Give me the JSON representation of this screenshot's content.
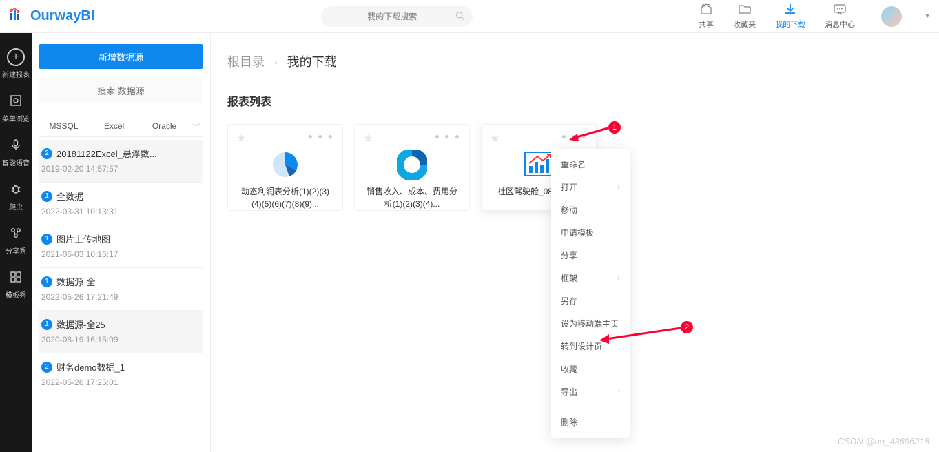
{
  "app_name": "OurwayBI",
  "search_placeholder": "我的下载搜索",
  "top_actions": {
    "share": "共享",
    "favorites": "收藏夹",
    "downloads": "我的下载",
    "messages": "消息中心"
  },
  "rail": {
    "new_report": "新建报表",
    "browse": "菜单浏览",
    "voice": "智能语音",
    "spider": "爬虫",
    "share_show": "分享秀",
    "template_show": "模板秀"
  },
  "sidebar": {
    "add_ds_label": "新增数据源",
    "search_ds_placeholder": "搜索 数据源",
    "tabs": [
      "MSSQL",
      "Excel",
      "Oracle"
    ],
    "items": [
      {
        "badge": "2",
        "name": "20181122Excel_悬浮数...",
        "time": "2019-02-20 14:57:57"
      },
      {
        "badge": "1",
        "name": "全数据",
        "time": "2022-03-31 10:13:31"
      },
      {
        "badge": "1",
        "name": "图片上传地图",
        "time": "2021-06-03 10:16:17"
      },
      {
        "badge": "1",
        "name": "数据源-全",
        "time": "2022-05-26 17:21:49"
      },
      {
        "badge": "1",
        "name": "数据源-全25",
        "time": "2020-08-19 16:15:09"
      },
      {
        "badge": "2",
        "name": "财务demo数据_1",
        "time": "2022-05-26 17:25:01"
      }
    ]
  },
  "breadcrumb": {
    "root": "根目录",
    "current": "我的下载"
  },
  "section_title": "报表列表",
  "cards": [
    {
      "title": "动态利润表分析(1)(2)(3)(4)(5)(6)(7)(8)(9)..."
    },
    {
      "title": "销售收入、成本、费用分析(1)(2)(3)(4)..."
    },
    {
      "title": "社区驾驶舱_08191615"
    }
  ],
  "context_menu": {
    "rename": "重命名",
    "open": "打开",
    "move": "移动",
    "apply_template": "申请模板",
    "share": "分享",
    "frame": "框架",
    "save_as": "另存",
    "set_mobile_home": "设为移动端主页",
    "goto_design": "转到设计页",
    "favorite": "收藏",
    "export": "导出",
    "delete": "删除"
  },
  "annotations": {
    "a1": "1",
    "a2": "2"
  },
  "watermark": "CSDN @qq_43696218"
}
